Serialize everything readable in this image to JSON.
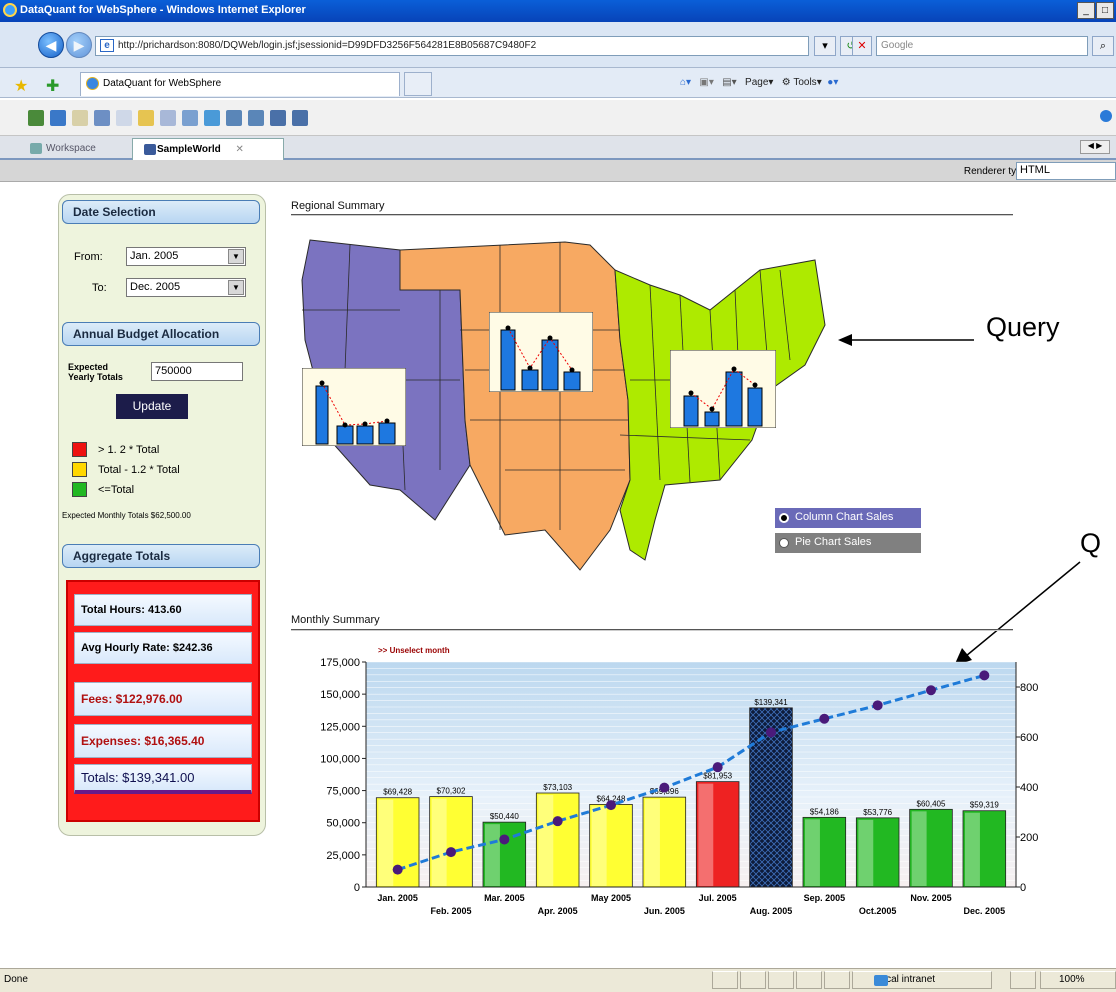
{
  "browser": {
    "window_title": "DataQuant for WebSphere - Windows Internet Explorer",
    "url": "http://prichardson:8080/DQWeb/login.jsf;jsessionid=D99DFD3256F564281E8B05687C9480F2",
    "search_placeholder": "Google",
    "tab_title": "DataQuant for WebSphere",
    "commands": [
      "Page",
      "Tools"
    ],
    "status_left": "Done",
    "zone": "Local intranet",
    "zoom": "100%"
  },
  "app": {
    "tabs": [
      "Workspace",
      "SampleWorld"
    ],
    "renderer_label": "Renderer type:",
    "renderer_value": "HTML"
  },
  "left": {
    "date_header": "Date Selection",
    "from_label": "From:",
    "from_value": "Jan. 2005",
    "to_label": "To:",
    "to_value": "Dec. 2005",
    "budget_header": "Annual Budget Allocation",
    "expected_label_1": "Expected",
    "expected_label_2": "Yearly Totals",
    "expected_value": "750000",
    "update_label": "Update",
    "legend": [
      {
        "label": "> 1. 2 * Total",
        "color": "#ee1111"
      },
      {
        "label": "Total - 1.2 * Total",
        "color": "#ffd700"
      },
      {
        "label": "<=Total",
        "color": "#22b822"
      }
    ],
    "monthly_note": "Expected Monthly Totals $62,500.00",
    "aggregate_header": "Aggregate Totals",
    "total_hours": "Total Hours: 413.60",
    "avg_rate": "Avg Hourly Rate: $242.36",
    "fees": "Fees: $122,976.00",
    "expenses": "Expenses: $16,365.40",
    "totals": "Totals: $139,341.00"
  },
  "main": {
    "regional_title": "Regional Summary",
    "monthly_title": "Monthly Summary",
    "unselect_label": ">> Unselect month",
    "radio_options": [
      "Column Chart Sales",
      "Pie Chart Sales"
    ],
    "annotation_query": "Query",
    "annotation_q": "Q"
  },
  "chart_data": {
    "type": "bar",
    "categories": [
      "Jan. 2005",
      "Feb. 2005",
      "Mar. 2005",
      "Apr. 2005",
      "May 2005",
      "Jun. 2005",
      "Jul. 2005",
      "Aug. 2005",
      "Sep. 2005",
      "Oct.2005",
      "Nov. 2005",
      "Dec. 2005"
    ],
    "values": [
      69428,
      70302,
      50440,
      73103,
      64248,
      69896,
      81953,
      139341,
      54186,
      53776,
      60405,
      59319
    ],
    "data_labels": [
      "$69,428",
      "$70,302",
      "$50,440",
      "$73,103",
      "$64,248",
      "$69,896",
      "$81,953",
      "$139,341",
      "$54,186",
      "$53,776",
      "$60,405",
      "$59,319"
    ],
    "bar_colors": [
      "#ffff33",
      "#ffff33",
      "#22b822",
      "#ffff33",
      "#ffff33",
      "#ffff33",
      "#ee2222",
      "#112244",
      "#22b822",
      "#22b822",
      "#22b822",
      "#22b822"
    ],
    "cumulative": [
      69428,
      139730,
      190170,
      263273,
      327521,
      397417,
      479370,
      618711,
      672897,
      726673,
      787078,
      846397
    ],
    "ylim_left": [
      0,
      175000
    ],
    "yticks_left": [
      "0",
      "25,000",
      "50,000",
      "75,000",
      "100,000",
      "125,000",
      "150,000",
      "175,000"
    ],
    "ylim_right": [
      0,
      900000
    ],
    "yticks_right": [
      "0",
      "200,000",
      "400,000",
      "600,000",
      "800,000"
    ]
  }
}
